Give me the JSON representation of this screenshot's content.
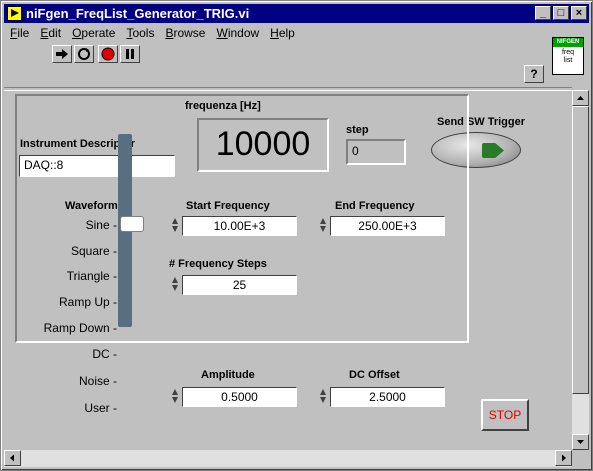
{
  "window": {
    "title": "niFgen_FreqList_Generator_TRIG.vi"
  },
  "menu": [
    "File",
    "Edit",
    "Operate",
    "Tools",
    "Browse",
    "Window",
    "Help"
  ],
  "logo": {
    "header": "NIFGEN",
    "body_line1": "freq",
    "body_line2": "list"
  },
  "help_button": "?",
  "instrument": {
    "label": "Instrument Descriptor",
    "value": "DAQ::8"
  },
  "frequency": {
    "label": "frequenza [Hz]",
    "value": "10000"
  },
  "step": {
    "label": "step",
    "value": "0"
  },
  "trigger": {
    "label": "Send SW Trigger"
  },
  "waveform": {
    "label": "Waveform",
    "options": [
      "Sine",
      "Square",
      "Triangle",
      "Ramp Up",
      "Ramp Down",
      "DC",
      "Noise",
      "User"
    ],
    "selected": "Sine"
  },
  "start_frequency": {
    "label": "Start Frequency",
    "value": "10.00E+3"
  },
  "end_frequency": {
    "label": "End Frequency",
    "value": "250.00E+3"
  },
  "frequency_steps": {
    "label": "# Frequency Steps",
    "value": "25"
  },
  "amplitude": {
    "label": "Amplitude",
    "value": "0.5000"
  },
  "dc_offset": {
    "label": "DC Offset",
    "value": "2.5000"
  },
  "stop_button": {
    "label": "STOP"
  }
}
